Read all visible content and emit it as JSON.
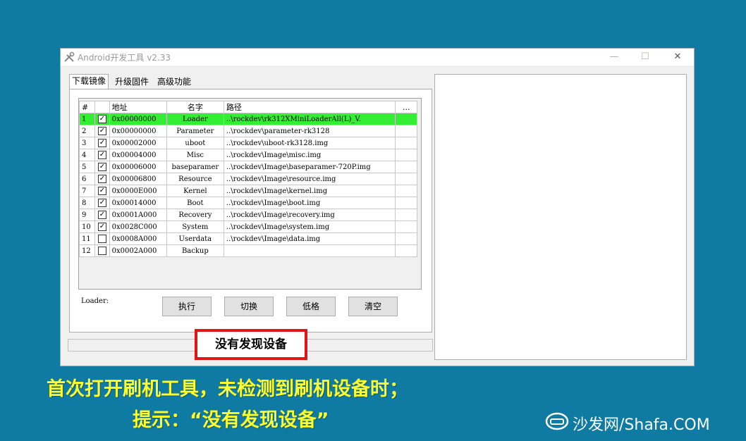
{
  "window": {
    "title": "Android开发工具 v2.33",
    "minimize": "—",
    "maximize": "☐",
    "close": "✕"
  },
  "tabs": [
    {
      "label": "下载镜像",
      "active": true
    },
    {
      "label": "升级固件",
      "active": false
    },
    {
      "label": "高级功能",
      "active": false
    }
  ],
  "grid": {
    "headers": [
      "#",
      "",
      "地址",
      "名字",
      "路径",
      "..."
    ],
    "rows": [
      {
        "num": "1",
        "checked": true,
        "addr": "0x00000000",
        "name": "Loader",
        "path": "..\\rockdev\\rk312XMiniLoaderAll(L)_V.",
        "selected": true
      },
      {
        "num": "2",
        "checked": true,
        "addr": "0x00000000",
        "name": "Parameter",
        "path": "..\\rockdev\\parameter-rk3128"
      },
      {
        "num": "3",
        "checked": true,
        "addr": "0x00002000",
        "name": "uboot",
        "path": "..\\rockdev\\uboot-rk3128.img"
      },
      {
        "num": "4",
        "checked": true,
        "addr": "0x00004000",
        "name": "Misc",
        "path": "..\\rockdev\\Image\\misc.img"
      },
      {
        "num": "5",
        "checked": true,
        "addr": "0x00006000",
        "name": "baseparamer",
        "path": "..\\rockdev\\Image\\baseparamer-720P.img"
      },
      {
        "num": "6",
        "checked": true,
        "addr": "0x00006800",
        "name": "Resource",
        "path": "..\\rockdev\\Image\\resource.img"
      },
      {
        "num": "7",
        "checked": true,
        "addr": "0x0000E000",
        "name": "Kernel",
        "path": "..\\rockdev\\Image\\kernel.img"
      },
      {
        "num": "8",
        "checked": true,
        "addr": "0x00014000",
        "name": "Boot",
        "path": "..\\rockdev\\Image\\boot.img"
      },
      {
        "num": "9",
        "checked": true,
        "addr": "0x0001A000",
        "name": "Recovery",
        "path": "..\\rockdev\\Image\\recovery.img"
      },
      {
        "num": "10",
        "checked": true,
        "addr": "0x0028C000",
        "name": "System",
        "path": "..\\rockdev\\Image\\system.img"
      },
      {
        "num": "11",
        "checked": false,
        "addr": "0x0008A000",
        "name": "Userdata",
        "path": "..\\rockdev\\Image\\data.img"
      },
      {
        "num": "12",
        "checked": false,
        "addr": "0x0002A000",
        "name": "Backup",
        "path": ""
      }
    ]
  },
  "loader_label": "Loader:",
  "buttons": {
    "run": "执行",
    "switch": "切换",
    "lowformat": "低格",
    "clear": "清空"
  },
  "status": "没有发现设备",
  "captions": {
    "line1": "首次打开刷机工具，未检测到刷机设备时；",
    "line2": "提示：“没有发现设备”"
  },
  "watermark": "沙发网/Shafa.COM",
  "colors": {
    "background": "#0f7ba2",
    "selected_row": "#33ee33",
    "status_border": "#e01515",
    "caption": "#ffff2a"
  }
}
